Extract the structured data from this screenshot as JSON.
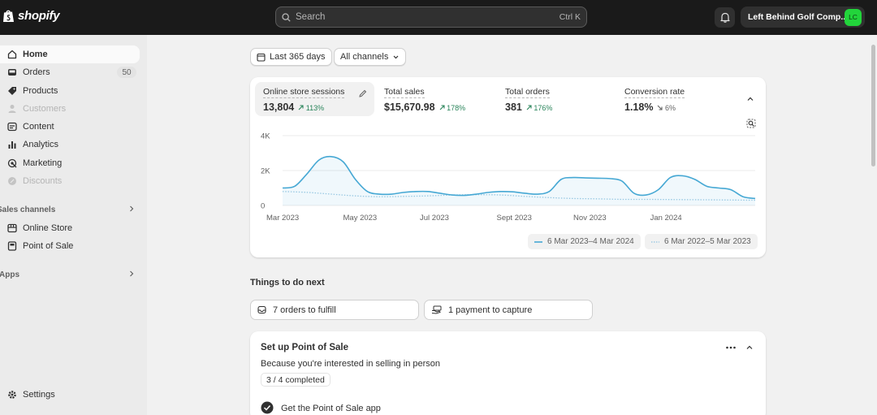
{
  "topbar": {
    "logo_text": "shopify",
    "search_placeholder": "Search",
    "search_shortcut": "Ctrl K",
    "store_name": "Left Behind Golf Comp...",
    "avatar_initials": "LC"
  },
  "sidebar": {
    "items": [
      {
        "label": "Home"
      },
      {
        "label": "Orders",
        "badge": "50"
      },
      {
        "label": "Products"
      },
      {
        "label": "Customers"
      },
      {
        "label": "Content"
      },
      {
        "label": "Analytics"
      },
      {
        "label": "Marketing"
      },
      {
        "label": "Discounts"
      }
    ],
    "sales_channels_title": "Sales channels",
    "sales_channels": [
      {
        "label": "Online Store"
      },
      {
        "label": "Point of Sale"
      }
    ],
    "apps_title": "Apps",
    "settings_label": "Settings"
  },
  "filters": {
    "date_range": "Last 365 days",
    "channels": "All channels"
  },
  "metrics": [
    {
      "label": "Online store sessions",
      "value": "13,804",
      "change": "113%"
    },
    {
      "label": "Total sales",
      "value": "$15,670.98",
      "change": "178%"
    },
    {
      "label": "Total orders",
      "value": "381",
      "change": "176%"
    },
    {
      "label": "Conversion rate",
      "value": "1.18%",
      "change": "6%"
    }
  ],
  "chart_data": {
    "type": "line",
    "y_ticks": [
      "4K",
      "2K",
      "0"
    ],
    "x_ticks": [
      "Mar 2023",
      "May 2023",
      "Jul 2023",
      "Sept 2023",
      "Nov 2023",
      "Jan 2024"
    ],
    "ylim": [
      0,
      4000
    ],
    "grid": true,
    "series": [
      {
        "name": "6 Mar 2023–4 Mar 2024",
        "color": "#46a8d4",
        "style": "solid-area",
        "points": [
          [
            0,
            1000
          ],
          [
            3,
            1100
          ],
          [
            6,
            1800
          ],
          [
            9,
            2600
          ],
          [
            12,
            2800
          ],
          [
            15,
            2500
          ],
          [
            18,
            1500
          ],
          [
            21,
            800
          ],
          [
            24,
            650
          ],
          [
            27,
            650
          ],
          [
            30,
            750
          ],
          [
            33,
            800
          ],
          [
            36,
            800
          ],
          [
            39,
            700
          ],
          [
            42,
            600
          ],
          [
            45,
            580
          ],
          [
            48,
            650
          ],
          [
            51,
            750
          ],
          [
            54,
            800
          ],
          [
            57,
            780
          ],
          [
            60,
            700
          ],
          [
            63,
            650
          ],
          [
            66,
            800
          ],
          [
            69,
            1500
          ],
          [
            72,
            1600
          ],
          [
            75,
            1580
          ],
          [
            78,
            1560
          ],
          [
            81,
            1540
          ],
          [
            84,
            1400
          ],
          [
            87,
            700
          ],
          [
            90,
            600
          ],
          [
            93,
            900
          ],
          [
            96,
            1600
          ],
          [
            99,
            1700
          ],
          [
            102,
            1500
          ],
          [
            105,
            1100
          ],
          [
            108,
            1000
          ],
          [
            111,
            900
          ],
          [
            114,
            500
          ],
          [
            117,
            400
          ]
        ]
      },
      {
        "name": "6 Mar 2022–5 Mar 2023",
        "color": "#9fcbe3",
        "style": "dotted",
        "points": [
          [
            0,
            800
          ],
          [
            6,
            750
          ],
          [
            12,
            650
          ],
          [
            18,
            550
          ],
          [
            24,
            500
          ],
          [
            30,
            520
          ],
          [
            36,
            550
          ],
          [
            42,
            600
          ],
          [
            48,
            620
          ],
          [
            54,
            600
          ],
          [
            60,
            520
          ],
          [
            66,
            450
          ],
          [
            72,
            400
          ],
          [
            78,
            380
          ],
          [
            84,
            350
          ],
          [
            90,
            350
          ],
          [
            96,
            340
          ],
          [
            102,
            330
          ],
          [
            108,
            320
          ],
          [
            117,
            300
          ]
        ]
      }
    ]
  },
  "things_title": "Things to do next",
  "tasks": [
    {
      "label": "7 orders to fulfill"
    },
    {
      "label": "1 payment to capture"
    }
  ],
  "pos": {
    "title": "Set up Point of Sale",
    "subtitle": "Because you're interested in selling in person",
    "progress": "3 / 4 completed",
    "step_label": "Get the Point of Sale app"
  }
}
